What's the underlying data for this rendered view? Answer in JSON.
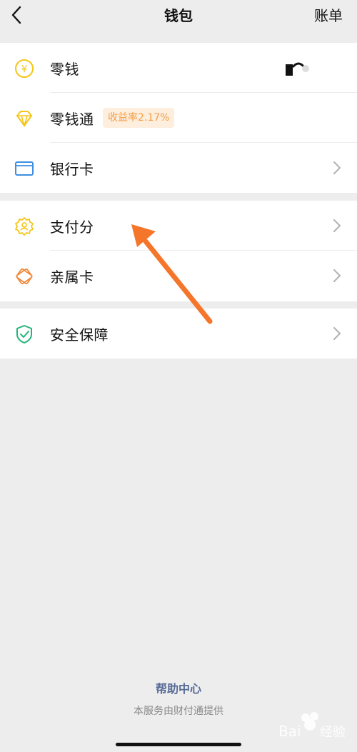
{
  "nav": {
    "title": "钱包",
    "bill": "账单"
  },
  "rows": {
    "change": {
      "label": "零钱",
      "icon": "yen-coin-icon"
    },
    "change_plus": {
      "label": "零钱通",
      "badge": "收益率2.17%",
      "icon": "diamond-icon"
    },
    "bank_card": {
      "label": "银行卡",
      "icon": "card-icon"
    },
    "pay_score": {
      "label": "支付分",
      "icon": "badge-person-icon"
    },
    "family_card": {
      "label": "亲属卡",
      "icon": "family-card-icon"
    },
    "security": {
      "label": "安全保障",
      "icon": "shield-check-icon"
    }
  },
  "footer": {
    "help": "帮助中心",
    "provider": "本服务由财付通提供"
  },
  "watermark": {
    "text": "Bai 经验"
  },
  "colors": {
    "accent_yellow": "#f5c518",
    "accent_blue": "#3d8fe0",
    "accent_orange": "#f0883a",
    "accent_green": "#23b57a",
    "link": "#566a96",
    "arrow": "#f5752b"
  }
}
